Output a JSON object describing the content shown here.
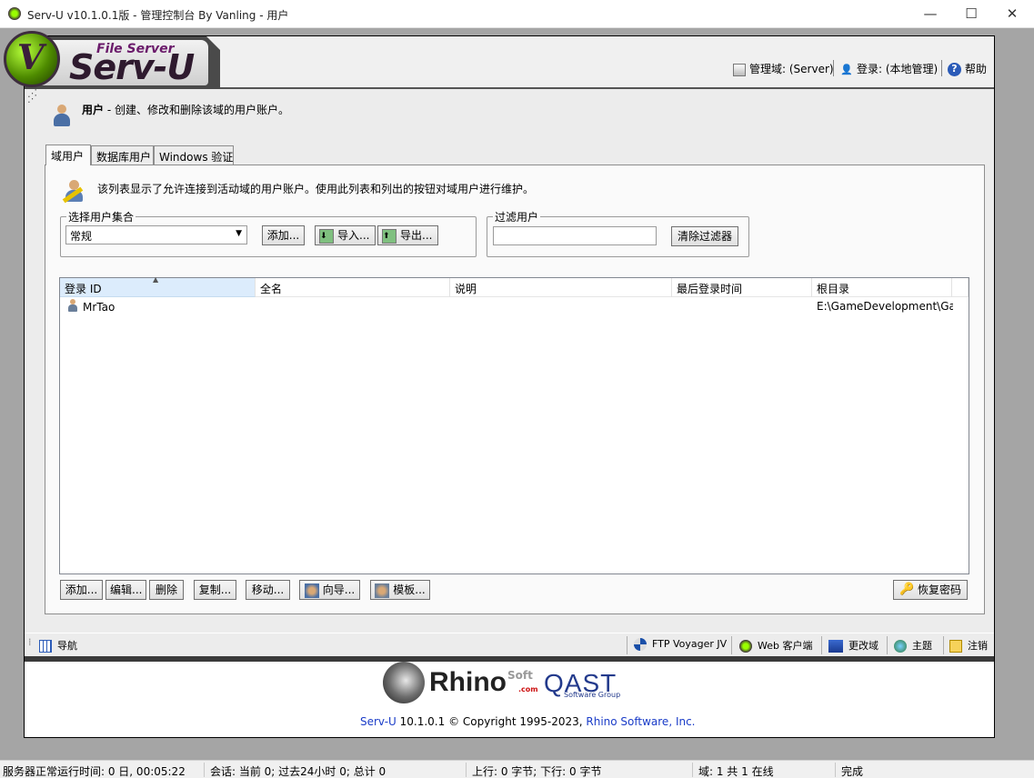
{
  "window": {
    "title": "Serv-U v10.1.0.1版 - 管理控制台  By Vanling - 用户",
    "minimize": "—",
    "maximize": "☐",
    "close": "✕"
  },
  "branding": {
    "logo_small": "File Server",
    "logo_big": "Serv-U",
    "logo_letter": "V"
  },
  "header": {
    "domain_label": "管理域: (Server)",
    "login_label": "登录: (本地管理)",
    "help_label": "帮助"
  },
  "page": {
    "title_bold": "用户",
    "title_rest": " - 创建、修改和删除该域的用户账户。"
  },
  "tabs": [
    {
      "label": "域用户",
      "active": true
    },
    {
      "label": "数据库用户",
      "active": false
    },
    {
      "label": "Windows 验证",
      "active": false
    }
  ],
  "panel": {
    "description": "该列表显示了允许连接到活动域的用户账户。使用此列表和列出的按钮对域用户进行维护。",
    "user_set_legend": "选择用户集合",
    "user_set_value": "常规",
    "add_label": "添加...",
    "import_label": "导入...",
    "export_label": "导出...",
    "filter_legend": "过滤用户",
    "filter_value": "",
    "clear_filter_label": "清除过滤器"
  },
  "list": {
    "columns": [
      "登录 ID",
      "全名",
      "说明",
      "最后登录时间",
      "根目录"
    ],
    "rows": [
      {
        "login_id": "MrTao",
        "full_name": "",
        "description": "",
        "last_login": "",
        "root_dir": "E:\\GameDevelopment\\Ga..."
      }
    ]
  },
  "actions": {
    "add": "添加...",
    "edit": "编辑...",
    "delete": "删除",
    "copy": "复制...",
    "move": "移动...",
    "wizard": "向导...",
    "template": "模板...",
    "recover_password": "恢复密码"
  },
  "navbar": {
    "nav": "导航",
    "ftp_voyager": "FTP Voyager JV",
    "web_client": "Web 客户端",
    "change_domain": "更改域",
    "theme": "主题",
    "logout": "注销"
  },
  "footer": {
    "rhino": "Rhino",
    "soft": "Soft",
    "com": ".com",
    "qast": "QAST",
    "qast_sub": "Software Group",
    "copyright_prefix": "Serv-U",
    "copyright_mid": " 10.1.0.1 © Copyright 1995-2023, ",
    "copyright_link": "Rhino Software, Inc."
  },
  "statusbar": {
    "uptime": "服务器正常运行时间: 0 日, 00:05:22",
    "sessions": "会话: 当前 0; 过去24小时 0; 总计 0",
    "transfer": "上行: 0 字节; 下行: 0 字节",
    "domain": "域: 1 共 1 在线",
    "state": "完成"
  }
}
